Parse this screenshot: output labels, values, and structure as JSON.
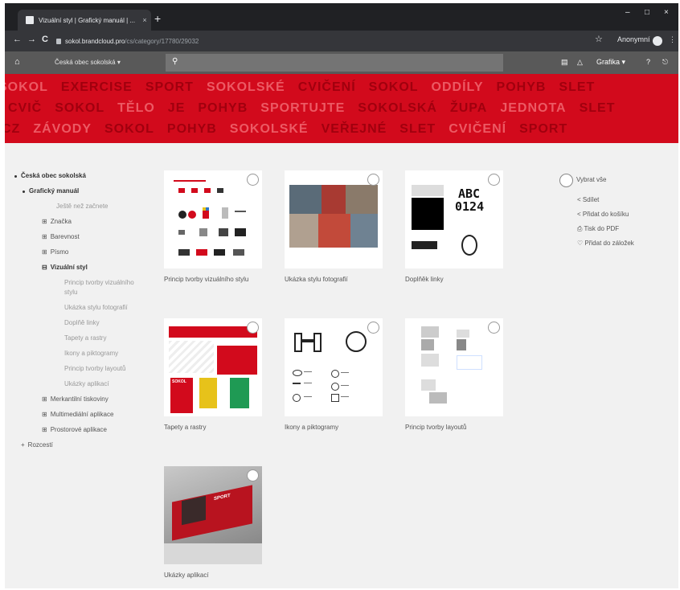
{
  "browser": {
    "tab_title": "Vizuální styl | Grafický manuál | ...",
    "tab_close": "×",
    "new_tab": "+",
    "minimize": "–",
    "maximize": "□",
    "close": "×",
    "url_host": "sokol.brandcloud.pro",
    "url_path": "/cs/category/17780/29032",
    "profile_label": "Anonymní",
    "back": "←",
    "forward": "→",
    "reload": "C",
    "star": "☆",
    "menu": "⋮"
  },
  "app": {
    "home_icon": "⌂",
    "brand_selector": "Česká obec sokolská ▾",
    "search_placeholder": "",
    "cart_icon": "🛒",
    "bell_icon": "🔔",
    "user_label": "Grafika ▾",
    "help_icon": "?",
    "logout_icon": "⎋"
  },
  "banner": {
    "rows": [
      [
        "SOKOL",
        "EXERCISE",
        "SPORT",
        "SOKOLSKÉ",
        "CVIČENÍ",
        "SOKOL",
        "ODDÍLY",
        "POHYB",
        "SLET"
      ],
      [
        "CVIČ",
        "SOKOL",
        "TĚLO",
        "JE",
        "POHYB",
        "SPORTUJTE",
        "SOKOLSKÁ",
        "ŽUPA",
        "JEDNOTA",
        "SLET"
      ],
      [
        "CZ",
        "ZÁVODY",
        "SOKOL",
        "POHYB",
        "SOKOLSKÉ",
        "VEŘEJNÉ",
        "SLET",
        "CVIČENÍ",
        "SPORT"
      ]
    ],
    "color": "#d20a1c"
  },
  "tree": [
    {
      "label": "Česká obec sokolská",
      "level": 0,
      "bold": true,
      "bullet": true
    },
    {
      "label": "Grafický manuál",
      "level": 1,
      "bold": true,
      "bullet": true
    },
    {
      "label": "Ještě než začnete",
      "level": 2,
      "light": true
    },
    {
      "label": "Značka",
      "level": 1,
      "prefix": "⊞"
    },
    {
      "label": "Barevnost",
      "level": 1,
      "prefix": "⊞"
    },
    {
      "label": "Písmo",
      "level": 1,
      "prefix": "⊞"
    },
    {
      "label": "Vizuální styl",
      "level": 1,
      "prefix": "⊟",
      "bold": true
    },
    {
      "label": "Princip tvorby vizuálního",
      "level": 3,
      "light": true
    },
    {
      "label": "stylu",
      "level": 3,
      "light": true
    },
    {
      "label": "Ukázka stylu fotografií",
      "level": 3,
      "light": true
    },
    {
      "label": "Doplňě linky",
      "level": 3,
      "light": true
    },
    {
      "label": "Tapety a rastry",
      "level": 3,
      "light": true
    },
    {
      "label": "Ikony a piktogramy",
      "level": 3,
      "light": true
    },
    {
      "label": "Princip tvorby layoutů",
      "level": 3,
      "light": true
    },
    {
      "label": "Ukázky aplikací",
      "level": 3,
      "light": true
    },
    {
      "label": "Merkantilní tiskoviny",
      "level": 1,
      "prefix": "⊞"
    },
    {
      "label": "Multimediální aplikace",
      "level": 1,
      "prefix": "⊞"
    },
    {
      "label": "Prostorové aplikace",
      "level": 1,
      "prefix": "⊞"
    },
    {
      "label": "Rozcestí",
      "level": 0,
      "prefix": "+"
    }
  ],
  "items": [
    {
      "caption": "Princip tvorby vizuálního stylu"
    },
    {
      "caption": "Ukázka stylu fotografií"
    },
    {
      "caption": "Doplňěk linky"
    },
    {
      "caption": "Tapety a rastry"
    },
    {
      "caption": "Ikony a piktogramy"
    },
    {
      "caption": "Princip tvorby layoutů"
    },
    {
      "caption": "Ukázky aplikací"
    }
  ],
  "thumb_text": {
    "abc": "ABC",
    "num": "0124",
    "shoes": "SPORT",
    "poster": "SOKOL"
  },
  "actions": {
    "select_all": "Vybrat vše",
    "share": "Sdílet",
    "add_to_cart": "Přidat do košíku",
    "print_pdf": "Tisk do PDF",
    "add_bookmark": "Přidat do záložek",
    "share_icon": "<",
    "cart_icon": "<",
    "pdf_icon": "⎙",
    "bookmark_icon": "♡"
  }
}
